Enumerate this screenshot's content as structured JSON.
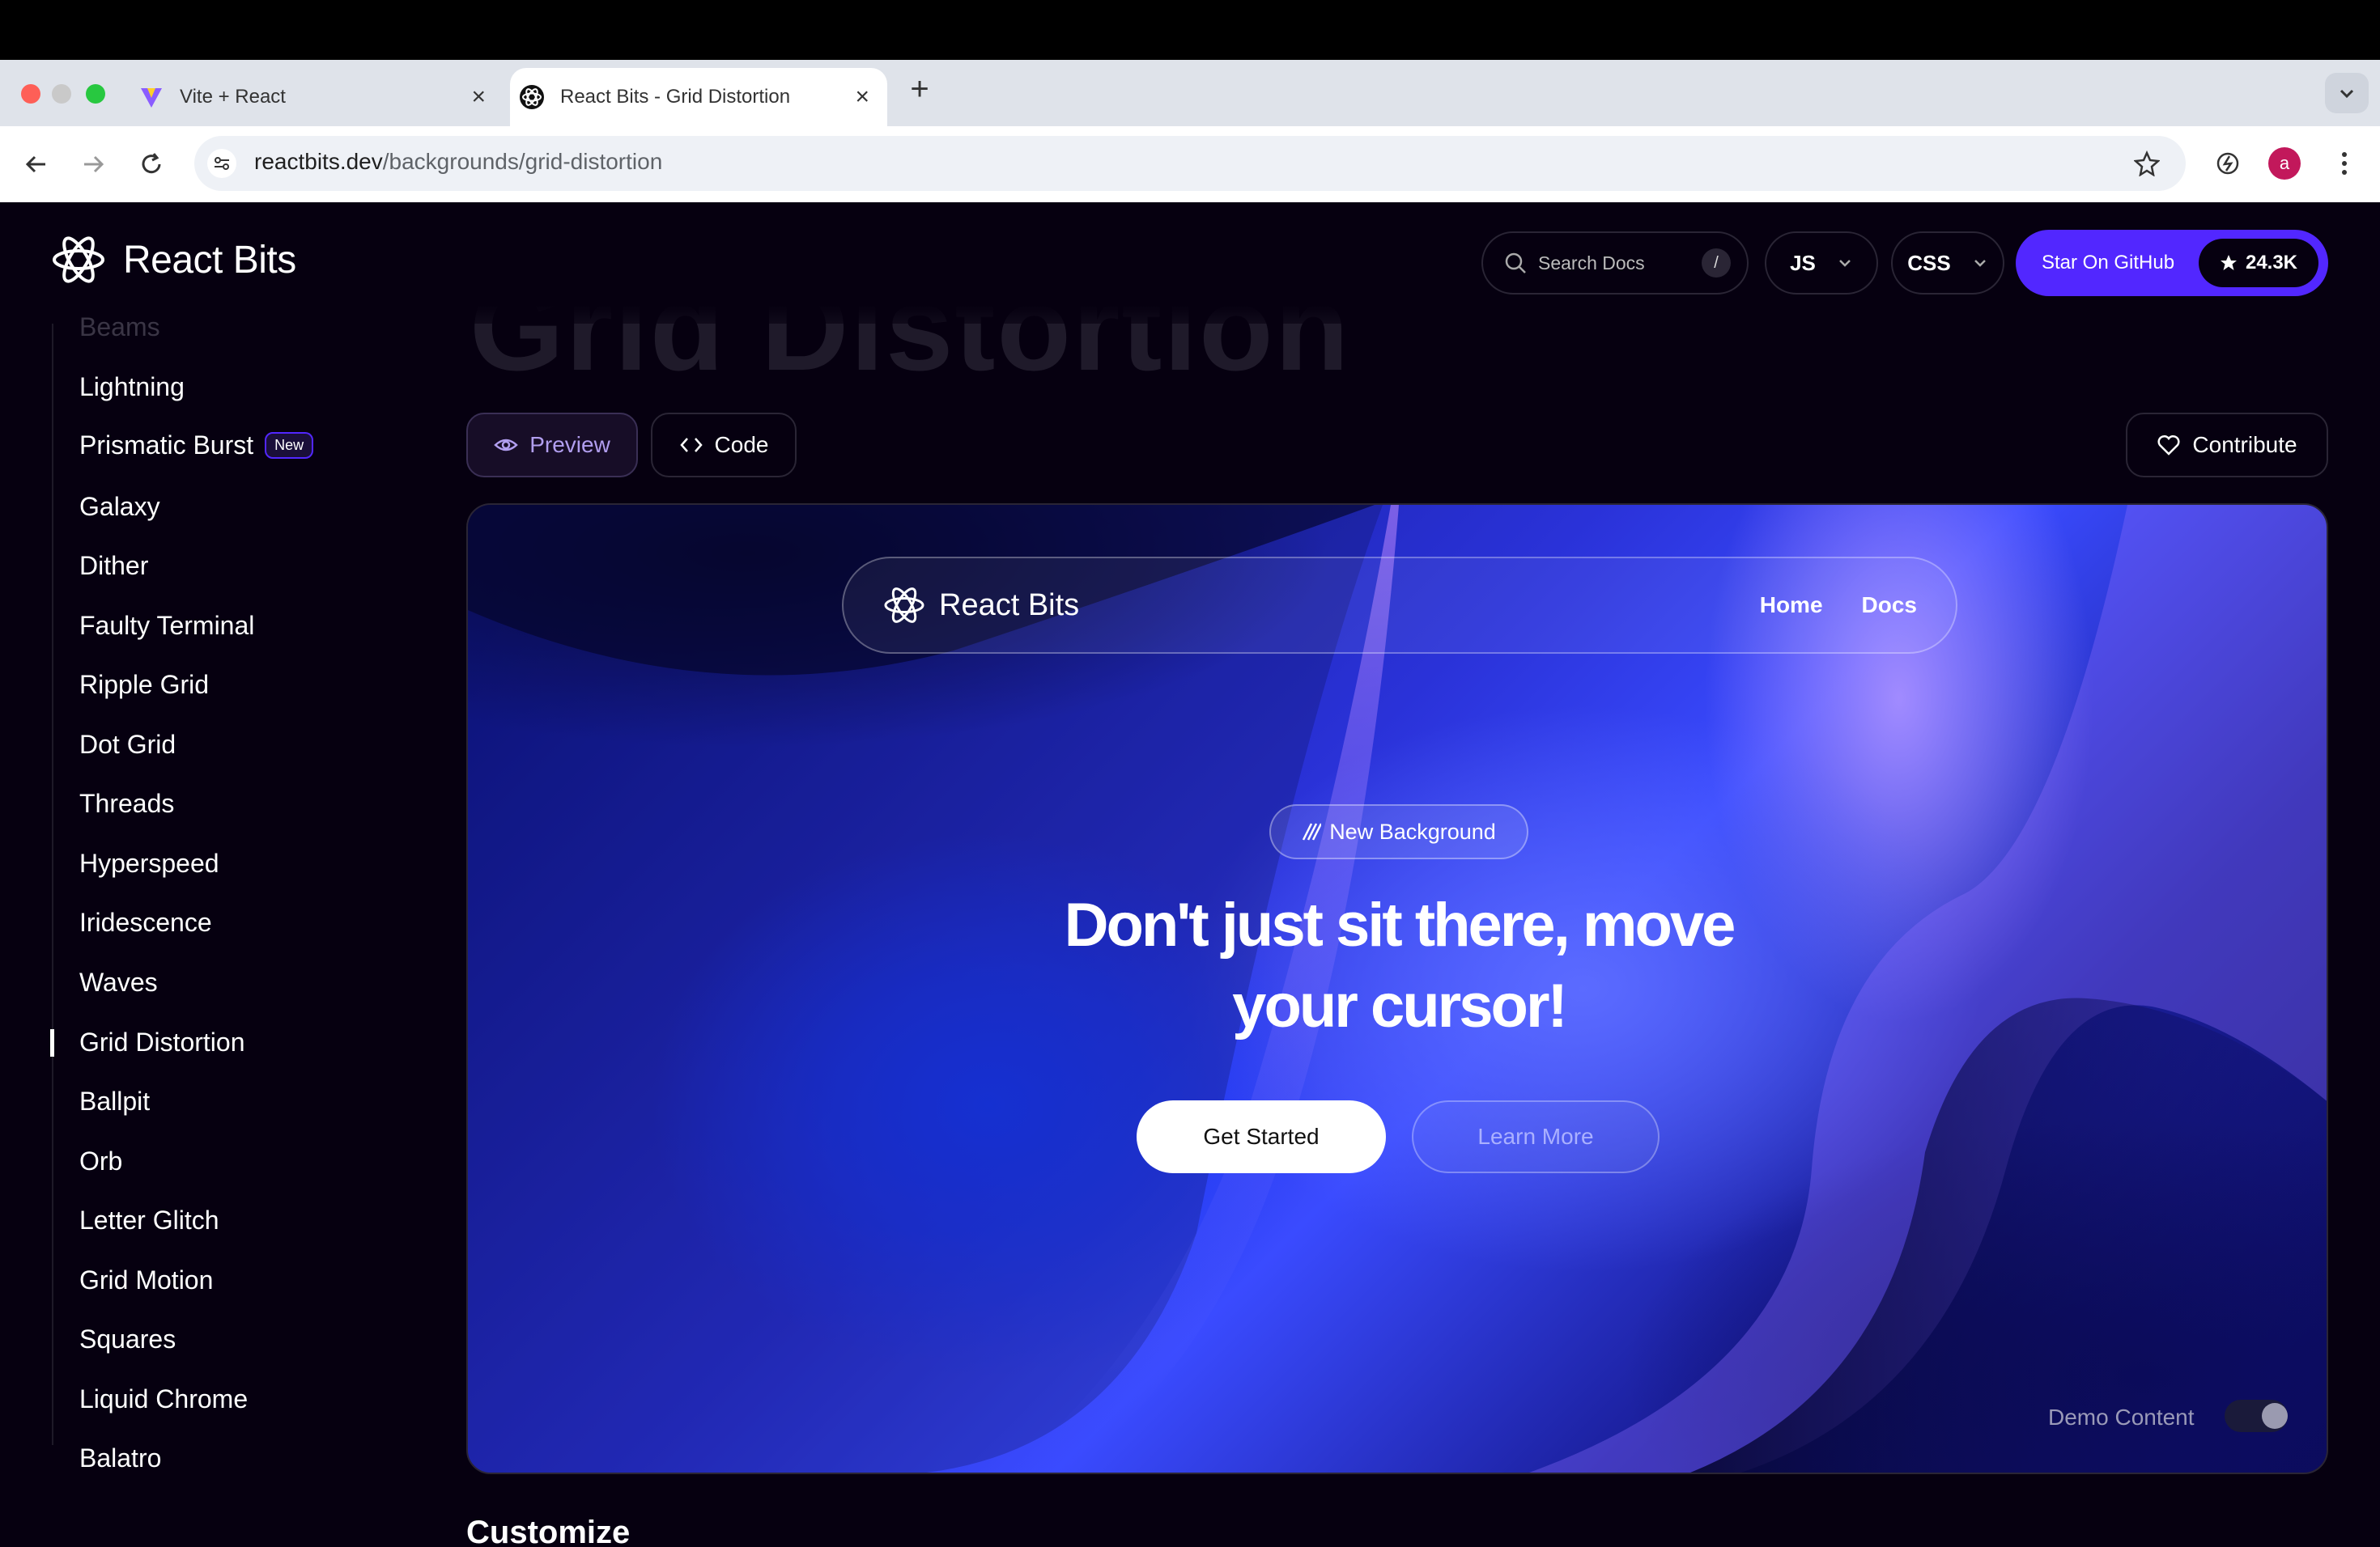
{
  "browser": {
    "tabs": [
      {
        "title": "Vite + React",
        "favicon": "vite-icon",
        "active": false
      },
      {
        "title": "React Bits - Grid Distortion",
        "favicon": "react-bits-icon",
        "active": true
      }
    ],
    "url_host": "reactbits.dev",
    "url_path": "/backgrounds/grid-distortion",
    "profile_initial": "a"
  },
  "header": {
    "brand": "React Bits",
    "search_placeholder": "Search Docs",
    "search_shortcut": "/",
    "lang_select": "JS",
    "style_select": "CSS",
    "star_label": "Star On GitHub",
    "star_count": "24.3K"
  },
  "page_title_ghost": "Grid Distortion",
  "sidebar": {
    "items": [
      {
        "label": "Beams"
      },
      {
        "label": "Lightning"
      },
      {
        "label": "Prismatic Burst",
        "badge": "New"
      },
      {
        "label": "Galaxy"
      },
      {
        "label": "Dither"
      },
      {
        "label": "Faulty Terminal"
      },
      {
        "label": "Ripple Grid"
      },
      {
        "label": "Dot Grid"
      },
      {
        "label": "Threads"
      },
      {
        "label": "Hyperspeed"
      },
      {
        "label": "Iridescence"
      },
      {
        "label": "Waves"
      },
      {
        "label": "Grid Distortion"
      },
      {
        "label": "Ballpit"
      },
      {
        "label": "Orb"
      },
      {
        "label": "Letter Glitch"
      },
      {
        "label": "Grid Motion"
      },
      {
        "label": "Squares"
      },
      {
        "label": "Liquid Chrome"
      },
      {
        "label": "Balatro"
      }
    ],
    "active": "Grid Distortion"
  },
  "view_tabs": {
    "preview": "Preview",
    "code": "Code"
  },
  "contribute": "Contribute",
  "demo": {
    "brand": "React Bits",
    "nav_links": [
      "Home",
      "Docs"
    ],
    "pill": "New Background",
    "headline_line1": "Don't just sit there, move",
    "headline_line2": "your cursor!",
    "primary_cta": "Get Started",
    "secondary_cta": "Learn More",
    "toggle_label": "Demo Content",
    "toggle_on": true
  },
  "section_heading": "Customize",
  "colors": {
    "accent": "#5227ff",
    "page_bg": "#060010"
  }
}
